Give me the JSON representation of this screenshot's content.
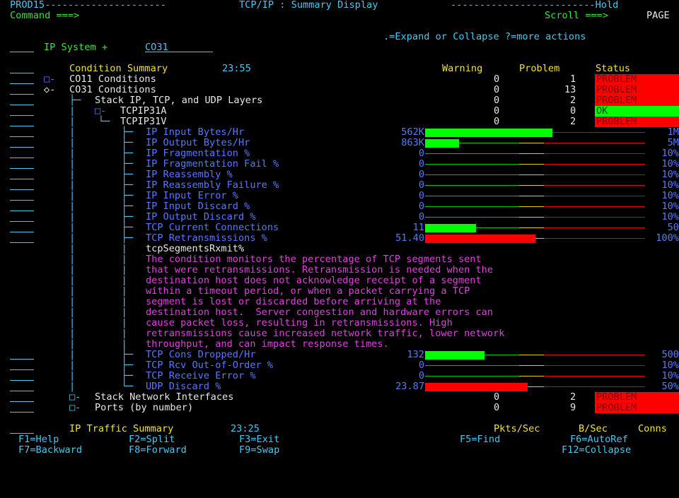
{
  "header": {
    "line1_left": "PROD15---------------------",
    "title": "TCP/IP : Summary Display",
    "line1_right": "-------------------------Hold",
    "command_label": "Command ===>",
    "scroll_label": "Scroll ===>",
    "scroll_value": "PAGE",
    "hint": ".=Expand or Collapse ?=more actions",
    "ip_system_label": "IP System +",
    "ip_system_value": "CO31"
  },
  "condition_summary": {
    "title": "Condition Summary",
    "time": "23:55",
    "col_warning": "Warning",
    "col_problem": "Problem",
    "col_status": "Status",
    "rows": [
      {
        "label": "CO11 Conditions",
        "marker": "□-",
        "warning": "0",
        "problem": "1",
        "status": "PROBLEM"
      },
      {
        "label": "CO31 Conditions",
        "marker": "◇-",
        "warning": "0",
        "problem": "13",
        "status": "PROBLEM"
      },
      {
        "label": "Stack IP, TCP, and UDP Layers",
        "warning": "0",
        "problem": "2",
        "status": "PROBLEM"
      },
      {
        "label": "TCPIP31A",
        "marker": "□-",
        "warning": "0",
        "problem": "0",
        "status": "OK"
      },
      {
        "label": "TCPIP31V",
        "warning": "0",
        "problem": "2",
        "status": "PROBLEM"
      }
    ]
  },
  "metrics": [
    {
      "label": "IP Input Bytes/Hr",
      "value": "562K",
      "max": "1M",
      "fill": 0.58,
      "color": "#00ff00"
    },
    {
      "label": "IP Output Bytes/Hr",
      "value": "863K",
      "max": "5M",
      "fill": 0.155,
      "color": "#00ff00"
    },
    {
      "label": "IP Fragmentation %",
      "value": "0",
      "max": "10%",
      "fill": 0,
      "color": "#00ff00"
    },
    {
      "label": "IP Fragmentation Fail %",
      "value": "0",
      "max": "10%",
      "fill": 0,
      "color": "#00ff00"
    },
    {
      "label": "IP Reassembly %",
      "value": "0",
      "max": "10%",
      "fill": 0,
      "color": "#00ff00"
    },
    {
      "label": "IP Reassembly Failure %",
      "value": "0",
      "max": "10%",
      "fill": 0,
      "color": "#00ff00"
    },
    {
      "label": "IP Input Error %",
      "value": "0",
      "max": "10%",
      "fill": 0,
      "color": "#00ff00"
    },
    {
      "label": "IP Input Discard %",
      "value": "0",
      "max": "10%",
      "fill": 0,
      "color": "#00ff00"
    },
    {
      "label": "IP Output Discard %",
      "value": "0",
      "max": "10%",
      "fill": 0,
      "color": "#00ff00"
    },
    {
      "label": "TCP Current Connections",
      "value": "11",
      "max": "50",
      "fill": 0.23,
      "color": "#00ff00"
    },
    {
      "label": "TCP Retransmissions %",
      "value": "51.40",
      "max": "100%",
      "fill": 0.5,
      "color": "#ff0000"
    }
  ],
  "description": {
    "metric_name": "tcpSegmentsRxmit%",
    "lines": [
      "The condition monitors the percentage of TCP segments sent",
      "that were retransmissions. Retransmission is needed when the",
      "destination host does not acknowledge receipt of a segment",
      "within a timeout period, or when a packet carrying a TCP",
      "segment is lost or discarded before arriving at the",
      "destination host.  Server congestion and hardware errors can",
      "cause packet loss, resulting in retransmissions. High",
      "retransmissions cause increased network traffic, lower network",
      "throughput, and can impact response times."
    ]
  },
  "metrics2": [
    {
      "label": "TCP Cons Dropped/Hr",
      "value": "132",
      "max": "500",
      "fill": 0.27,
      "color": "#00ff00"
    },
    {
      "label": "TCP Rcv Out-of-Order %",
      "value": "0",
      "max": "10%",
      "fill": 0,
      "color": "#00ff00"
    },
    {
      "label": "TCP Receive Error %",
      "value": "0",
      "max": "10%",
      "fill": 0,
      "color": "#00ff00"
    },
    {
      "label": "UDP Discard %",
      "value": "23.87",
      "max": "50%",
      "fill": 0.465,
      "color": "#ff0000"
    }
  ],
  "bottom_rows": [
    {
      "label": "Stack Network Interfaces",
      "marker": "□-",
      "warning": "0",
      "problem": "2",
      "status": "PROBLEM"
    },
    {
      "label": "Ports (by number)",
      "marker": "□-",
      "warning": "0",
      "problem": "9",
      "status": "PROBLEM"
    }
  ],
  "traffic": {
    "title": "IP Traffic Summary",
    "time": "23:25",
    "col1": "Pkts/Sec",
    "col2": "B/Sec",
    "col3": "Conns"
  },
  "fkeys_row1": [
    {
      "key": "F1=Help"
    },
    {
      "key": "F2=Split"
    },
    {
      "key": "F3=Exit"
    },
    {
      "key": "F5=Find"
    },
    {
      "key": "F6=AutoRef"
    }
  ],
  "fkeys_row2": [
    {
      "key": "F7=Backward"
    },
    {
      "key": "F8=Forward"
    },
    {
      "key": "F9=Swap"
    },
    {
      "key": "F12=Collapse"
    }
  ],
  "colors": {
    "problem": "#ff0000",
    "ok": "#00ff00",
    "background": "#000000"
  }
}
